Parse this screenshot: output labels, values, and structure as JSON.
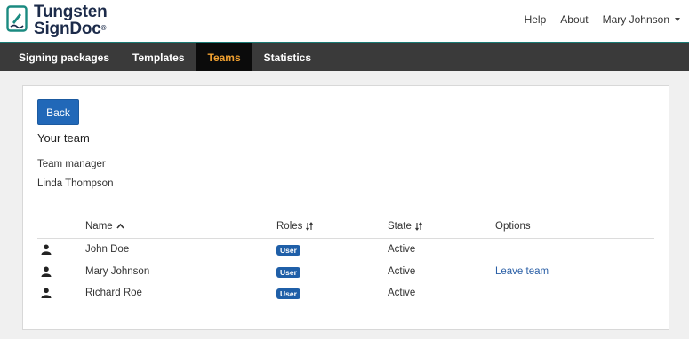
{
  "brand": {
    "line1": "Tungsten",
    "line2": "SignDoc",
    "mark": "®",
    "accent": "#1a8a80",
    "navy": "#1c2b4a"
  },
  "topnav": {
    "help": "Help",
    "about": "About",
    "user": "Mary Johnson"
  },
  "tabs": [
    {
      "label": "Signing packages",
      "active": false
    },
    {
      "label": "Templates",
      "active": false
    },
    {
      "label": "Teams",
      "active": true
    },
    {
      "label": "Statistics",
      "active": false
    }
  ],
  "colors": {
    "active_tab_text": "#f0a030",
    "primary_button": "#2168b8",
    "badge": "#1f5fa8",
    "link": "#2a5fa6"
  },
  "page": {
    "back_label": "Back",
    "section_title": "Your team",
    "manager_label": "Team manager",
    "manager_name": "Linda Thompson"
  },
  "table": {
    "headers": {
      "name": "Name",
      "roles": "Roles",
      "state": "State",
      "options": "Options"
    },
    "rows": [
      {
        "icon": "user-icon",
        "name": "John Doe",
        "role": "User",
        "state": "Active",
        "option": ""
      },
      {
        "icon": "user-icon",
        "name": "Mary Johnson",
        "role": "User",
        "state": "Active",
        "option": "Leave team"
      },
      {
        "icon": "user-icon",
        "name": "Richard Roe",
        "role": "User",
        "state": "Active",
        "option": ""
      }
    ]
  }
}
